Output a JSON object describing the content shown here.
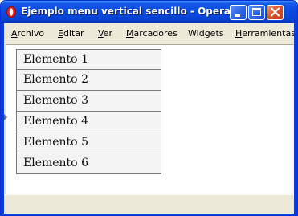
{
  "window": {
    "title": "Ejemplo menu vertical sencillo - Opera",
    "icon": "opera-logo-icon",
    "controls": [
      "minimize-icon",
      "maximize-icon",
      "close-icon"
    ]
  },
  "menubar": {
    "items": [
      {
        "before": "",
        "accel": "A",
        "after": "rchivo"
      },
      {
        "before": "",
        "accel": "E",
        "after": "ditar"
      },
      {
        "before": "",
        "accel": "V",
        "after": "er"
      },
      {
        "before": "",
        "accel": "M",
        "after": "arcadores"
      },
      {
        "before": "Wid",
        "accel": "g",
        "after": "ets"
      },
      {
        "before": "",
        "accel": "H",
        "after": "erramientas"
      }
    ]
  },
  "list": {
    "items": [
      "Elemento 1",
      "Elemento 2",
      "Elemento 3",
      "Elemento 4",
      "Elemento 5",
      "Elemento 6"
    ]
  },
  "colors": {
    "titlebar": "#0a4ce0",
    "window_border": "#0831d9",
    "chrome": "#ece9d8",
    "item_background": "#f4f4f4",
    "item_border": "#7a7a7a",
    "close_button": "#e0502d"
  }
}
